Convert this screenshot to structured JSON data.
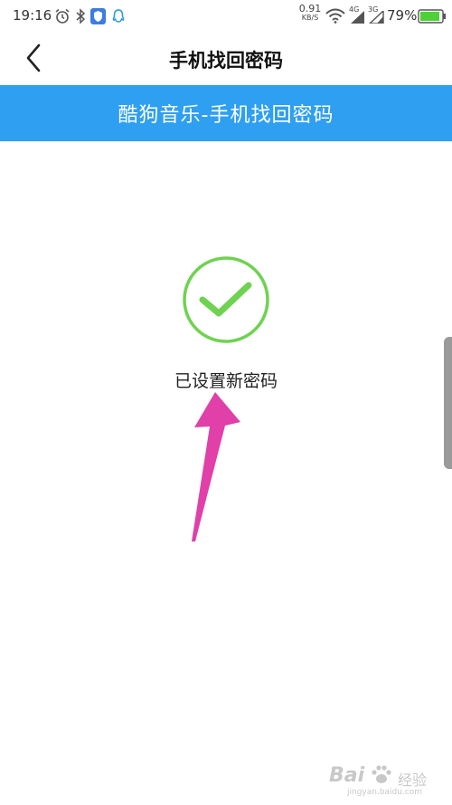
{
  "status_bar": {
    "time": "19:16",
    "speed_value": "0.91",
    "speed_unit": "KB/S",
    "net1": "4G",
    "net2": "3G",
    "battery_percent": "79%"
  },
  "header": {
    "title": "手机找回密码"
  },
  "banner": {
    "title": "酷狗音乐-手机找回密码"
  },
  "main": {
    "success_message": "已设置新密码"
  },
  "watermark": {
    "word": "Bai",
    "cn": "经验",
    "url": "jingyan.baidu.com"
  },
  "colors": {
    "accent_blue": "#2f9ff2",
    "success_green": "#6fd250",
    "arrow_pink": "#e040a8",
    "battery_green": "#4cd137"
  },
  "icons": [
    "alarm-icon",
    "bluetooth-icon",
    "shield-icon",
    "qq-icon",
    "wifi-icon",
    "signal-icon",
    "battery-icon",
    "back-icon",
    "check-circle-icon"
  ]
}
